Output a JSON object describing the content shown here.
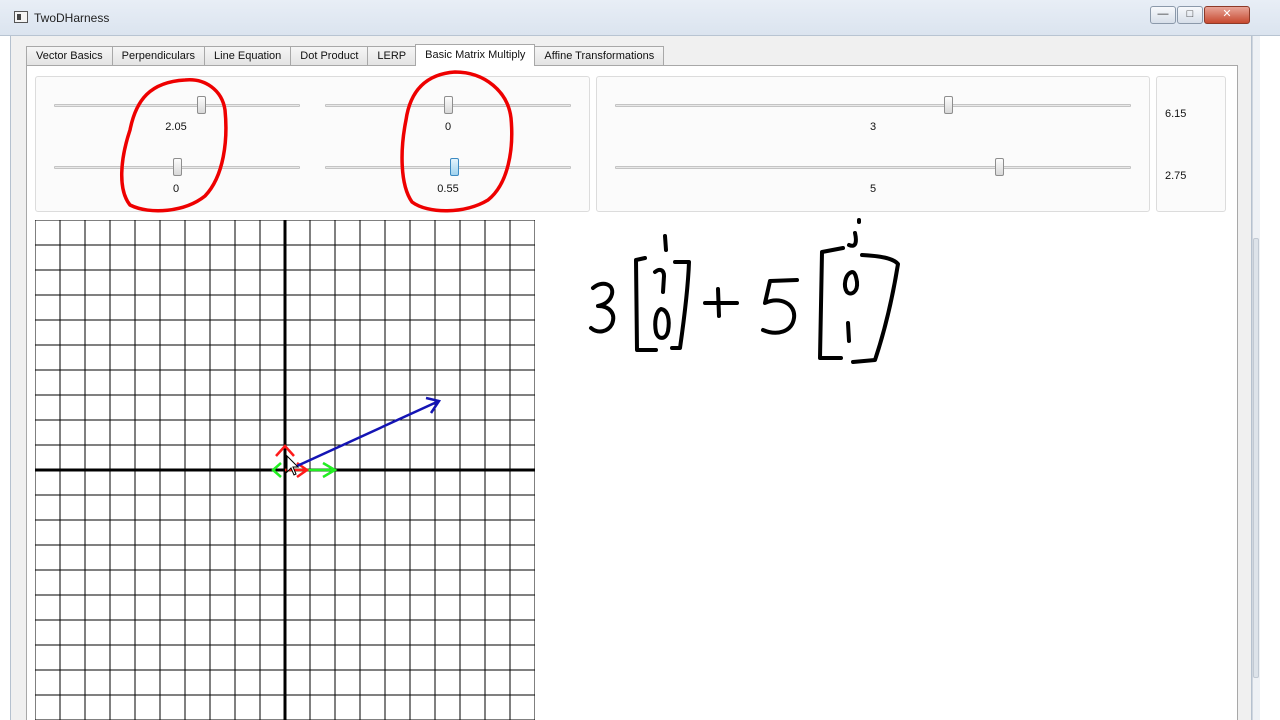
{
  "window": {
    "title": "TwoDHarness",
    "minimize_glyph": "—",
    "maximize_glyph": "□",
    "close_glyph": "✕"
  },
  "tabs": [
    {
      "label": "Vector Basics"
    },
    {
      "label": "Perpendiculars"
    },
    {
      "label": "Line Equation"
    },
    {
      "label": "Dot Product"
    },
    {
      "label": "LERP"
    },
    {
      "label": "Basic Matrix Multiply",
      "active": true
    },
    {
      "label": "Affine Transformations"
    }
  ],
  "matrix_sliders": {
    "col1_row1": {
      "value": 2.05,
      "label": "2.05"
    },
    "col1_row2": {
      "value": 0,
      "label": "0"
    },
    "col2_row1": {
      "value": 0,
      "label": "0"
    },
    "col2_row2": {
      "value": 0.55,
      "label": "0.55"
    }
  },
  "vector_sliders": {
    "x": {
      "value": 3,
      "label": "3"
    },
    "y": {
      "value": 5,
      "label": "5"
    }
  },
  "results": {
    "x": "6.15",
    "y": "2.75"
  },
  "colors": {
    "basis_i": "#ff1a1a",
    "basis_j": "#22ee22",
    "result_vector": "#1414b4",
    "ink": "#000000",
    "annotation_circle": "#ee0000",
    "grid_line": "#000000"
  },
  "cursor": {
    "icon": "arrow-cursor-icon"
  }
}
